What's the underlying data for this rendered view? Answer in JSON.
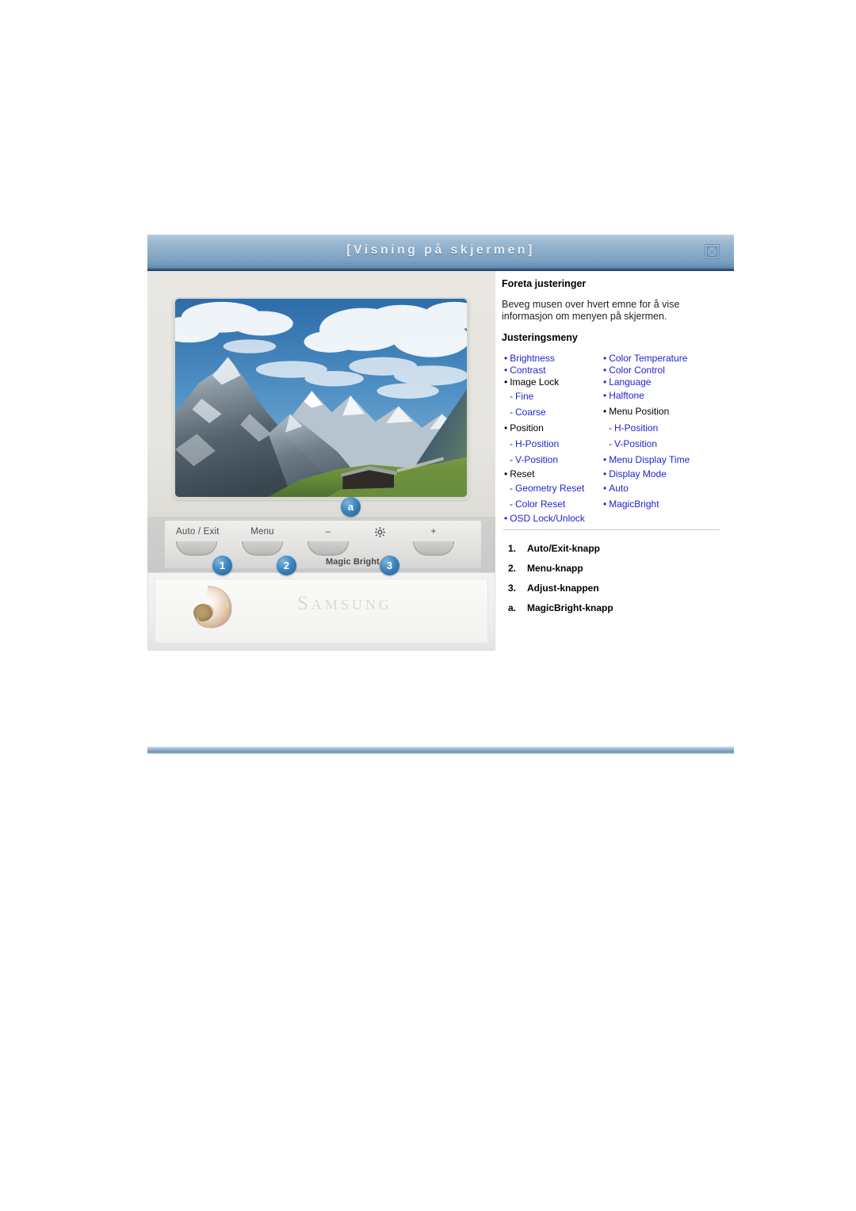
{
  "window": {
    "title": "[Visning på skjermen]",
    "close_icon": "close-icon"
  },
  "monitor": {
    "screen_image_alt": "mountain-landscape-photo",
    "controls": [
      {
        "label": "Auto / Exit",
        "icon": null,
        "badge": "1"
      },
      {
        "label": "Menu",
        "icon": null,
        "badge": "2"
      },
      {
        "label": "–",
        "icon": "minus-icon",
        "badge": "a"
      },
      {
        "label": "",
        "icon": "brightness-gear-icon",
        "badge": null
      },
      {
        "label": "+",
        "icon": "plus-icon",
        "badge": "3"
      }
    ],
    "magic_bright_label": "Magic Bright",
    "brand_wordmark": "Samsung",
    "shell_logo": "nautilus-shell-logo"
  },
  "panel": {
    "heading": "Foreta justeringer",
    "paragraph": "Beveg musen over hvert emne for å vise informasjon om menyen på skjermen.",
    "subheading": "Justeringsmeny",
    "menu_left": [
      {
        "marker": "•",
        "text": "Brightness",
        "link": true,
        "sub": false
      },
      {
        "marker": "•",
        "text": "Contrast",
        "link": true,
        "sub": false
      },
      {
        "marker": "•",
        "text": "Image Lock",
        "link": false,
        "sub": false
      },
      {
        "marker": "-",
        "text": "Fine",
        "link": true,
        "sub": true
      },
      {
        "marker": "-",
        "text": "Coarse",
        "link": true,
        "sub": true
      },
      {
        "marker": "•",
        "text": "Position",
        "link": false,
        "sub": false
      },
      {
        "marker": "-",
        "text": "H-Position",
        "link": true,
        "sub": true
      },
      {
        "marker": "-",
        "text": "V-Position",
        "link": true,
        "sub": true
      },
      {
        "marker": "•",
        "text": "Reset",
        "link": false,
        "sub": false
      },
      {
        "marker": "-",
        "text": "Geometry Reset",
        "link": true,
        "sub": true
      },
      {
        "marker": "-",
        "text": "Color Reset",
        "link": true,
        "sub": true
      },
      {
        "marker": "•",
        "text": "OSD Lock/Unlock",
        "link": true,
        "sub": false
      }
    ],
    "menu_right": [
      {
        "marker": "•",
        "text": "Color Temperature",
        "link": true,
        "sub": false
      },
      {
        "marker": "•",
        "text": "Color Control",
        "link": true,
        "sub": false
      },
      {
        "marker": "•",
        "text": "Language",
        "link": true,
        "sub": false
      },
      {
        "marker": "•",
        "text": "Halftone",
        "link": true,
        "sub": false
      },
      {
        "marker": "•",
        "text": "Menu Position",
        "link": false,
        "sub": false
      },
      {
        "marker": "-",
        "text": "H-Position",
        "link": true,
        "sub": true
      },
      {
        "marker": "-",
        "text": "V-Position",
        "link": true,
        "sub": true
      },
      {
        "marker": "•",
        "text": "Menu Display Time",
        "link": true,
        "sub": false
      },
      {
        "marker": "•",
        "text": "Display Mode",
        "link": true,
        "sub": false
      },
      {
        "marker": "•",
        "text": "Auto",
        "link": true,
        "sub": false
      },
      {
        "marker": "•",
        "text": "MagicBright",
        "link": true,
        "sub": false
      }
    ],
    "legend": [
      {
        "num": "1.",
        "text": "Auto/Exit-knapp"
      },
      {
        "num": "2.",
        "text": "Menu-knapp"
      },
      {
        "num": "3.",
        "text": "Adjust-knappen"
      },
      {
        "num": "a.",
        "text": "MagicBright-knapp"
      }
    ]
  },
  "colors": {
    "title_bar_blue": "#8cadc9",
    "link_blue": "#2222cc",
    "badge_blue": "#3d86bf",
    "rule_blue": "#87a9c6",
    "bezel_grey": "#e8e7e1"
  }
}
